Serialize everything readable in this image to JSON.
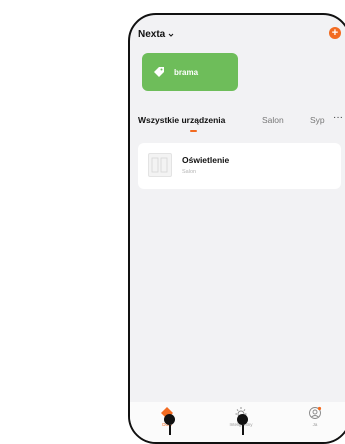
{
  "header": {
    "home_name": "Nexta",
    "add_icon": "+"
  },
  "scene": {
    "label": "brama",
    "icon": "tag-icon"
  },
  "tabs": {
    "items": [
      {
        "label": "Wszystkie urządzenia",
        "active": true
      },
      {
        "label": "Salon",
        "active": false
      },
      {
        "label": "Syp",
        "active": false
      }
    ],
    "more": "···"
  },
  "device": {
    "name": "Oświetlenie",
    "room": "Salon"
  },
  "nav": {
    "items": [
      {
        "label": "Dom",
        "icon": "home-icon",
        "active": true
      },
      {
        "label": "Inteligentny",
        "icon": "smart-icon",
        "active": false
      },
      {
        "label": "Ja",
        "icon": "profile-icon",
        "active": false
      }
    ]
  },
  "colors": {
    "accent": "#f26b21",
    "scene_green": "#6ebd5a"
  }
}
